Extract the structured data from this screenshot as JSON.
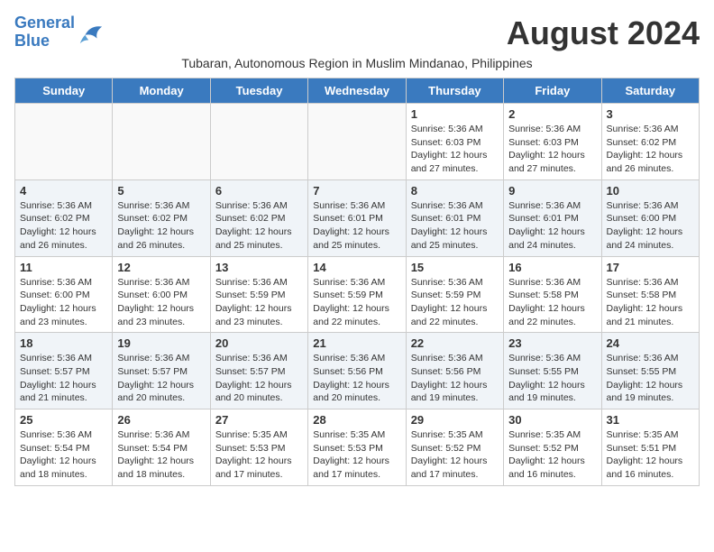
{
  "logo": {
    "line1": "General",
    "line2": "Blue"
  },
  "title": "August 2024",
  "subtitle": "Tubaran, Autonomous Region in Muslim Mindanao, Philippines",
  "weekdays": [
    "Sunday",
    "Monday",
    "Tuesday",
    "Wednesday",
    "Thursday",
    "Friday",
    "Saturday"
  ],
  "weeks": [
    [
      {
        "day": "",
        "info": ""
      },
      {
        "day": "",
        "info": ""
      },
      {
        "day": "",
        "info": ""
      },
      {
        "day": "",
        "info": ""
      },
      {
        "day": "1",
        "info": "Sunrise: 5:36 AM\nSunset: 6:03 PM\nDaylight: 12 hours\nand 27 minutes."
      },
      {
        "day": "2",
        "info": "Sunrise: 5:36 AM\nSunset: 6:03 PM\nDaylight: 12 hours\nand 27 minutes."
      },
      {
        "day": "3",
        "info": "Sunrise: 5:36 AM\nSunset: 6:02 PM\nDaylight: 12 hours\nand 26 minutes."
      }
    ],
    [
      {
        "day": "4",
        "info": "Sunrise: 5:36 AM\nSunset: 6:02 PM\nDaylight: 12 hours\nand 26 minutes."
      },
      {
        "day": "5",
        "info": "Sunrise: 5:36 AM\nSunset: 6:02 PM\nDaylight: 12 hours\nand 26 minutes."
      },
      {
        "day": "6",
        "info": "Sunrise: 5:36 AM\nSunset: 6:02 PM\nDaylight: 12 hours\nand 25 minutes."
      },
      {
        "day": "7",
        "info": "Sunrise: 5:36 AM\nSunset: 6:01 PM\nDaylight: 12 hours\nand 25 minutes."
      },
      {
        "day": "8",
        "info": "Sunrise: 5:36 AM\nSunset: 6:01 PM\nDaylight: 12 hours\nand 25 minutes."
      },
      {
        "day": "9",
        "info": "Sunrise: 5:36 AM\nSunset: 6:01 PM\nDaylight: 12 hours\nand 24 minutes."
      },
      {
        "day": "10",
        "info": "Sunrise: 5:36 AM\nSunset: 6:00 PM\nDaylight: 12 hours\nand 24 minutes."
      }
    ],
    [
      {
        "day": "11",
        "info": "Sunrise: 5:36 AM\nSunset: 6:00 PM\nDaylight: 12 hours\nand 23 minutes."
      },
      {
        "day": "12",
        "info": "Sunrise: 5:36 AM\nSunset: 6:00 PM\nDaylight: 12 hours\nand 23 minutes."
      },
      {
        "day": "13",
        "info": "Sunrise: 5:36 AM\nSunset: 5:59 PM\nDaylight: 12 hours\nand 23 minutes."
      },
      {
        "day": "14",
        "info": "Sunrise: 5:36 AM\nSunset: 5:59 PM\nDaylight: 12 hours\nand 22 minutes."
      },
      {
        "day": "15",
        "info": "Sunrise: 5:36 AM\nSunset: 5:59 PM\nDaylight: 12 hours\nand 22 minutes."
      },
      {
        "day": "16",
        "info": "Sunrise: 5:36 AM\nSunset: 5:58 PM\nDaylight: 12 hours\nand 22 minutes."
      },
      {
        "day": "17",
        "info": "Sunrise: 5:36 AM\nSunset: 5:58 PM\nDaylight: 12 hours\nand 21 minutes."
      }
    ],
    [
      {
        "day": "18",
        "info": "Sunrise: 5:36 AM\nSunset: 5:57 PM\nDaylight: 12 hours\nand 21 minutes."
      },
      {
        "day": "19",
        "info": "Sunrise: 5:36 AM\nSunset: 5:57 PM\nDaylight: 12 hours\nand 20 minutes."
      },
      {
        "day": "20",
        "info": "Sunrise: 5:36 AM\nSunset: 5:57 PM\nDaylight: 12 hours\nand 20 minutes."
      },
      {
        "day": "21",
        "info": "Sunrise: 5:36 AM\nSunset: 5:56 PM\nDaylight: 12 hours\nand 20 minutes."
      },
      {
        "day": "22",
        "info": "Sunrise: 5:36 AM\nSunset: 5:56 PM\nDaylight: 12 hours\nand 19 minutes."
      },
      {
        "day": "23",
        "info": "Sunrise: 5:36 AM\nSunset: 5:55 PM\nDaylight: 12 hours\nand 19 minutes."
      },
      {
        "day": "24",
        "info": "Sunrise: 5:36 AM\nSunset: 5:55 PM\nDaylight: 12 hours\nand 19 minutes."
      }
    ],
    [
      {
        "day": "25",
        "info": "Sunrise: 5:36 AM\nSunset: 5:54 PM\nDaylight: 12 hours\nand 18 minutes."
      },
      {
        "day": "26",
        "info": "Sunrise: 5:36 AM\nSunset: 5:54 PM\nDaylight: 12 hours\nand 18 minutes."
      },
      {
        "day": "27",
        "info": "Sunrise: 5:35 AM\nSunset: 5:53 PM\nDaylight: 12 hours\nand 17 minutes."
      },
      {
        "day": "28",
        "info": "Sunrise: 5:35 AM\nSunset: 5:53 PM\nDaylight: 12 hours\nand 17 minutes."
      },
      {
        "day": "29",
        "info": "Sunrise: 5:35 AM\nSunset: 5:52 PM\nDaylight: 12 hours\nand 17 minutes."
      },
      {
        "day": "30",
        "info": "Sunrise: 5:35 AM\nSunset: 5:52 PM\nDaylight: 12 hours\nand 16 minutes."
      },
      {
        "day": "31",
        "info": "Sunrise: 5:35 AM\nSunset: 5:51 PM\nDaylight: 12 hours\nand 16 minutes."
      }
    ]
  ]
}
